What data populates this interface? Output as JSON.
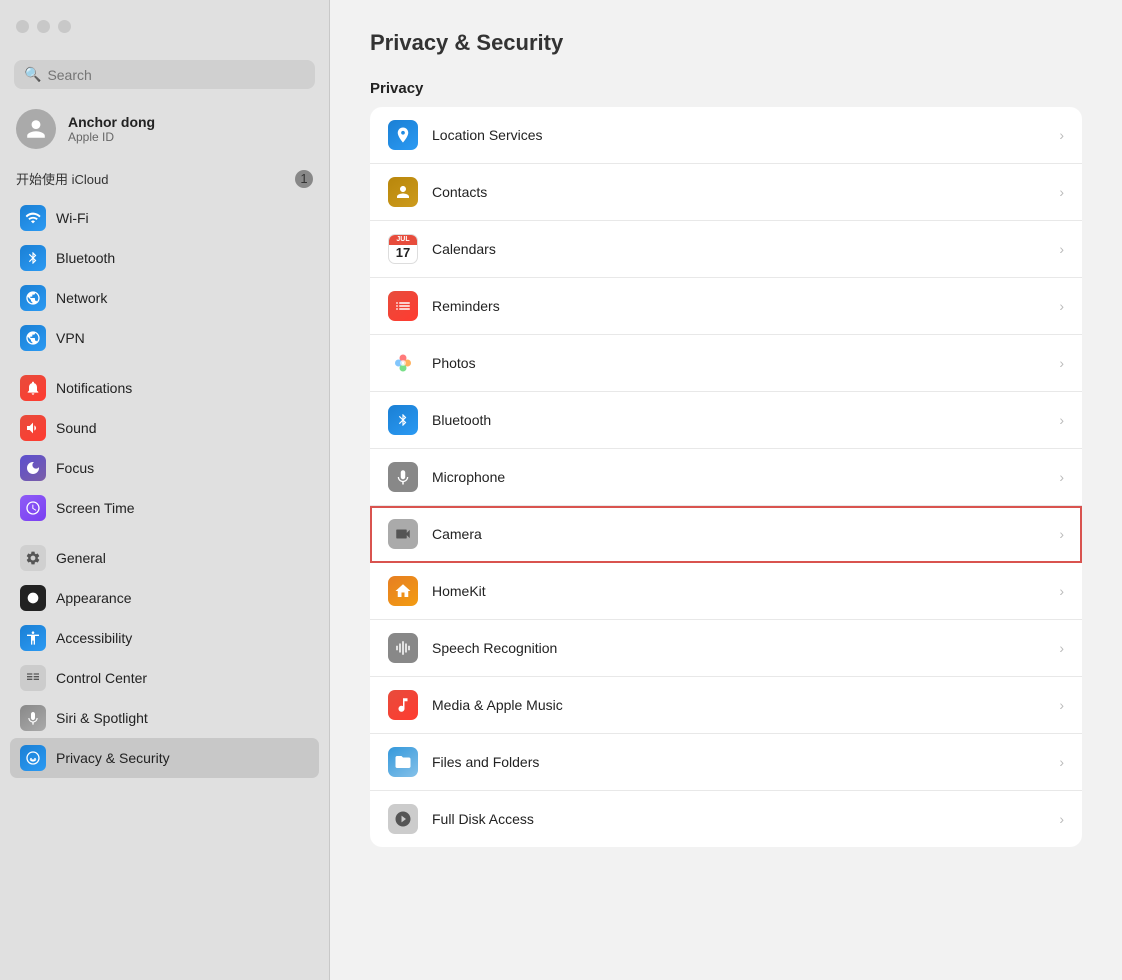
{
  "window": {
    "title": "Privacy & Security"
  },
  "sidebar": {
    "search_placeholder": "Search",
    "user": {
      "name": "Anchor dong",
      "apple_id": "Apple ID"
    },
    "icloud_label": "开始使用 iCloud",
    "icloud_badge": "1",
    "items": [
      {
        "id": "wifi",
        "label": "Wi-Fi",
        "icon": "wifi",
        "icon_char": "📶"
      },
      {
        "id": "bluetooth",
        "label": "Bluetooth",
        "icon": "bluetooth",
        "icon_char": "🔵"
      },
      {
        "id": "network",
        "label": "Network",
        "icon": "network",
        "icon_char": "🌐"
      },
      {
        "id": "vpn",
        "label": "VPN",
        "icon": "vpn",
        "icon_char": "🌐"
      },
      {
        "id": "notifications",
        "label": "Notifications",
        "icon": "notifications",
        "icon_char": "🔔"
      },
      {
        "id": "sound",
        "label": "Sound",
        "icon": "sound",
        "icon_char": "🔊"
      },
      {
        "id": "focus",
        "label": "Focus",
        "icon": "focus",
        "icon_char": "🌙"
      },
      {
        "id": "screentime",
        "label": "Screen Time",
        "icon": "screentime",
        "icon_char": "⏳"
      },
      {
        "id": "general",
        "label": "General",
        "icon": "general",
        "icon_char": "⚙️"
      },
      {
        "id": "appearance",
        "label": "Appearance",
        "icon": "appearance",
        "icon_char": "⚫"
      },
      {
        "id": "accessibility",
        "label": "Accessibility",
        "icon": "accessibility",
        "icon_char": "♿"
      },
      {
        "id": "controlcenter",
        "label": "Control Center",
        "icon": "controlcenter",
        "icon_char": "🎛️"
      },
      {
        "id": "siri",
        "label": "Siri & Spotlight",
        "icon": "siri",
        "icon_char": "🎤"
      },
      {
        "id": "privacy",
        "label": "Privacy & Security",
        "icon": "privacy",
        "icon_char": "✋",
        "active": true
      }
    ]
  },
  "main": {
    "page_title": "Privacy & Security",
    "section_privacy": "Privacy",
    "rows": [
      {
        "id": "location",
        "label": "Location Services",
        "icon_type": "location"
      },
      {
        "id": "contacts",
        "label": "Contacts",
        "icon_type": "contacts"
      },
      {
        "id": "calendars",
        "label": "Calendars",
        "icon_type": "calendars"
      },
      {
        "id": "reminders",
        "label": "Reminders",
        "icon_type": "reminders"
      },
      {
        "id": "photos",
        "label": "Photos",
        "icon_type": "photos"
      },
      {
        "id": "bluetooth",
        "label": "Bluetooth",
        "icon_type": "bluetooth"
      },
      {
        "id": "microphone",
        "label": "Microphone",
        "icon_type": "microphone"
      },
      {
        "id": "camera",
        "label": "Camera",
        "icon_type": "camera",
        "selected": true
      },
      {
        "id": "homekit",
        "label": "HomeKit",
        "icon_type": "homekit"
      },
      {
        "id": "speech",
        "label": "Speech Recognition",
        "icon_type": "speech"
      },
      {
        "id": "media",
        "label": "Media & Apple Music",
        "icon_type": "media"
      },
      {
        "id": "files",
        "label": "Files and Folders",
        "icon_type": "files"
      },
      {
        "id": "fulldisk",
        "label": "Full Disk Access",
        "icon_type": "fulldisk"
      }
    ],
    "cal_month": "JUL",
    "cal_day": "17"
  }
}
